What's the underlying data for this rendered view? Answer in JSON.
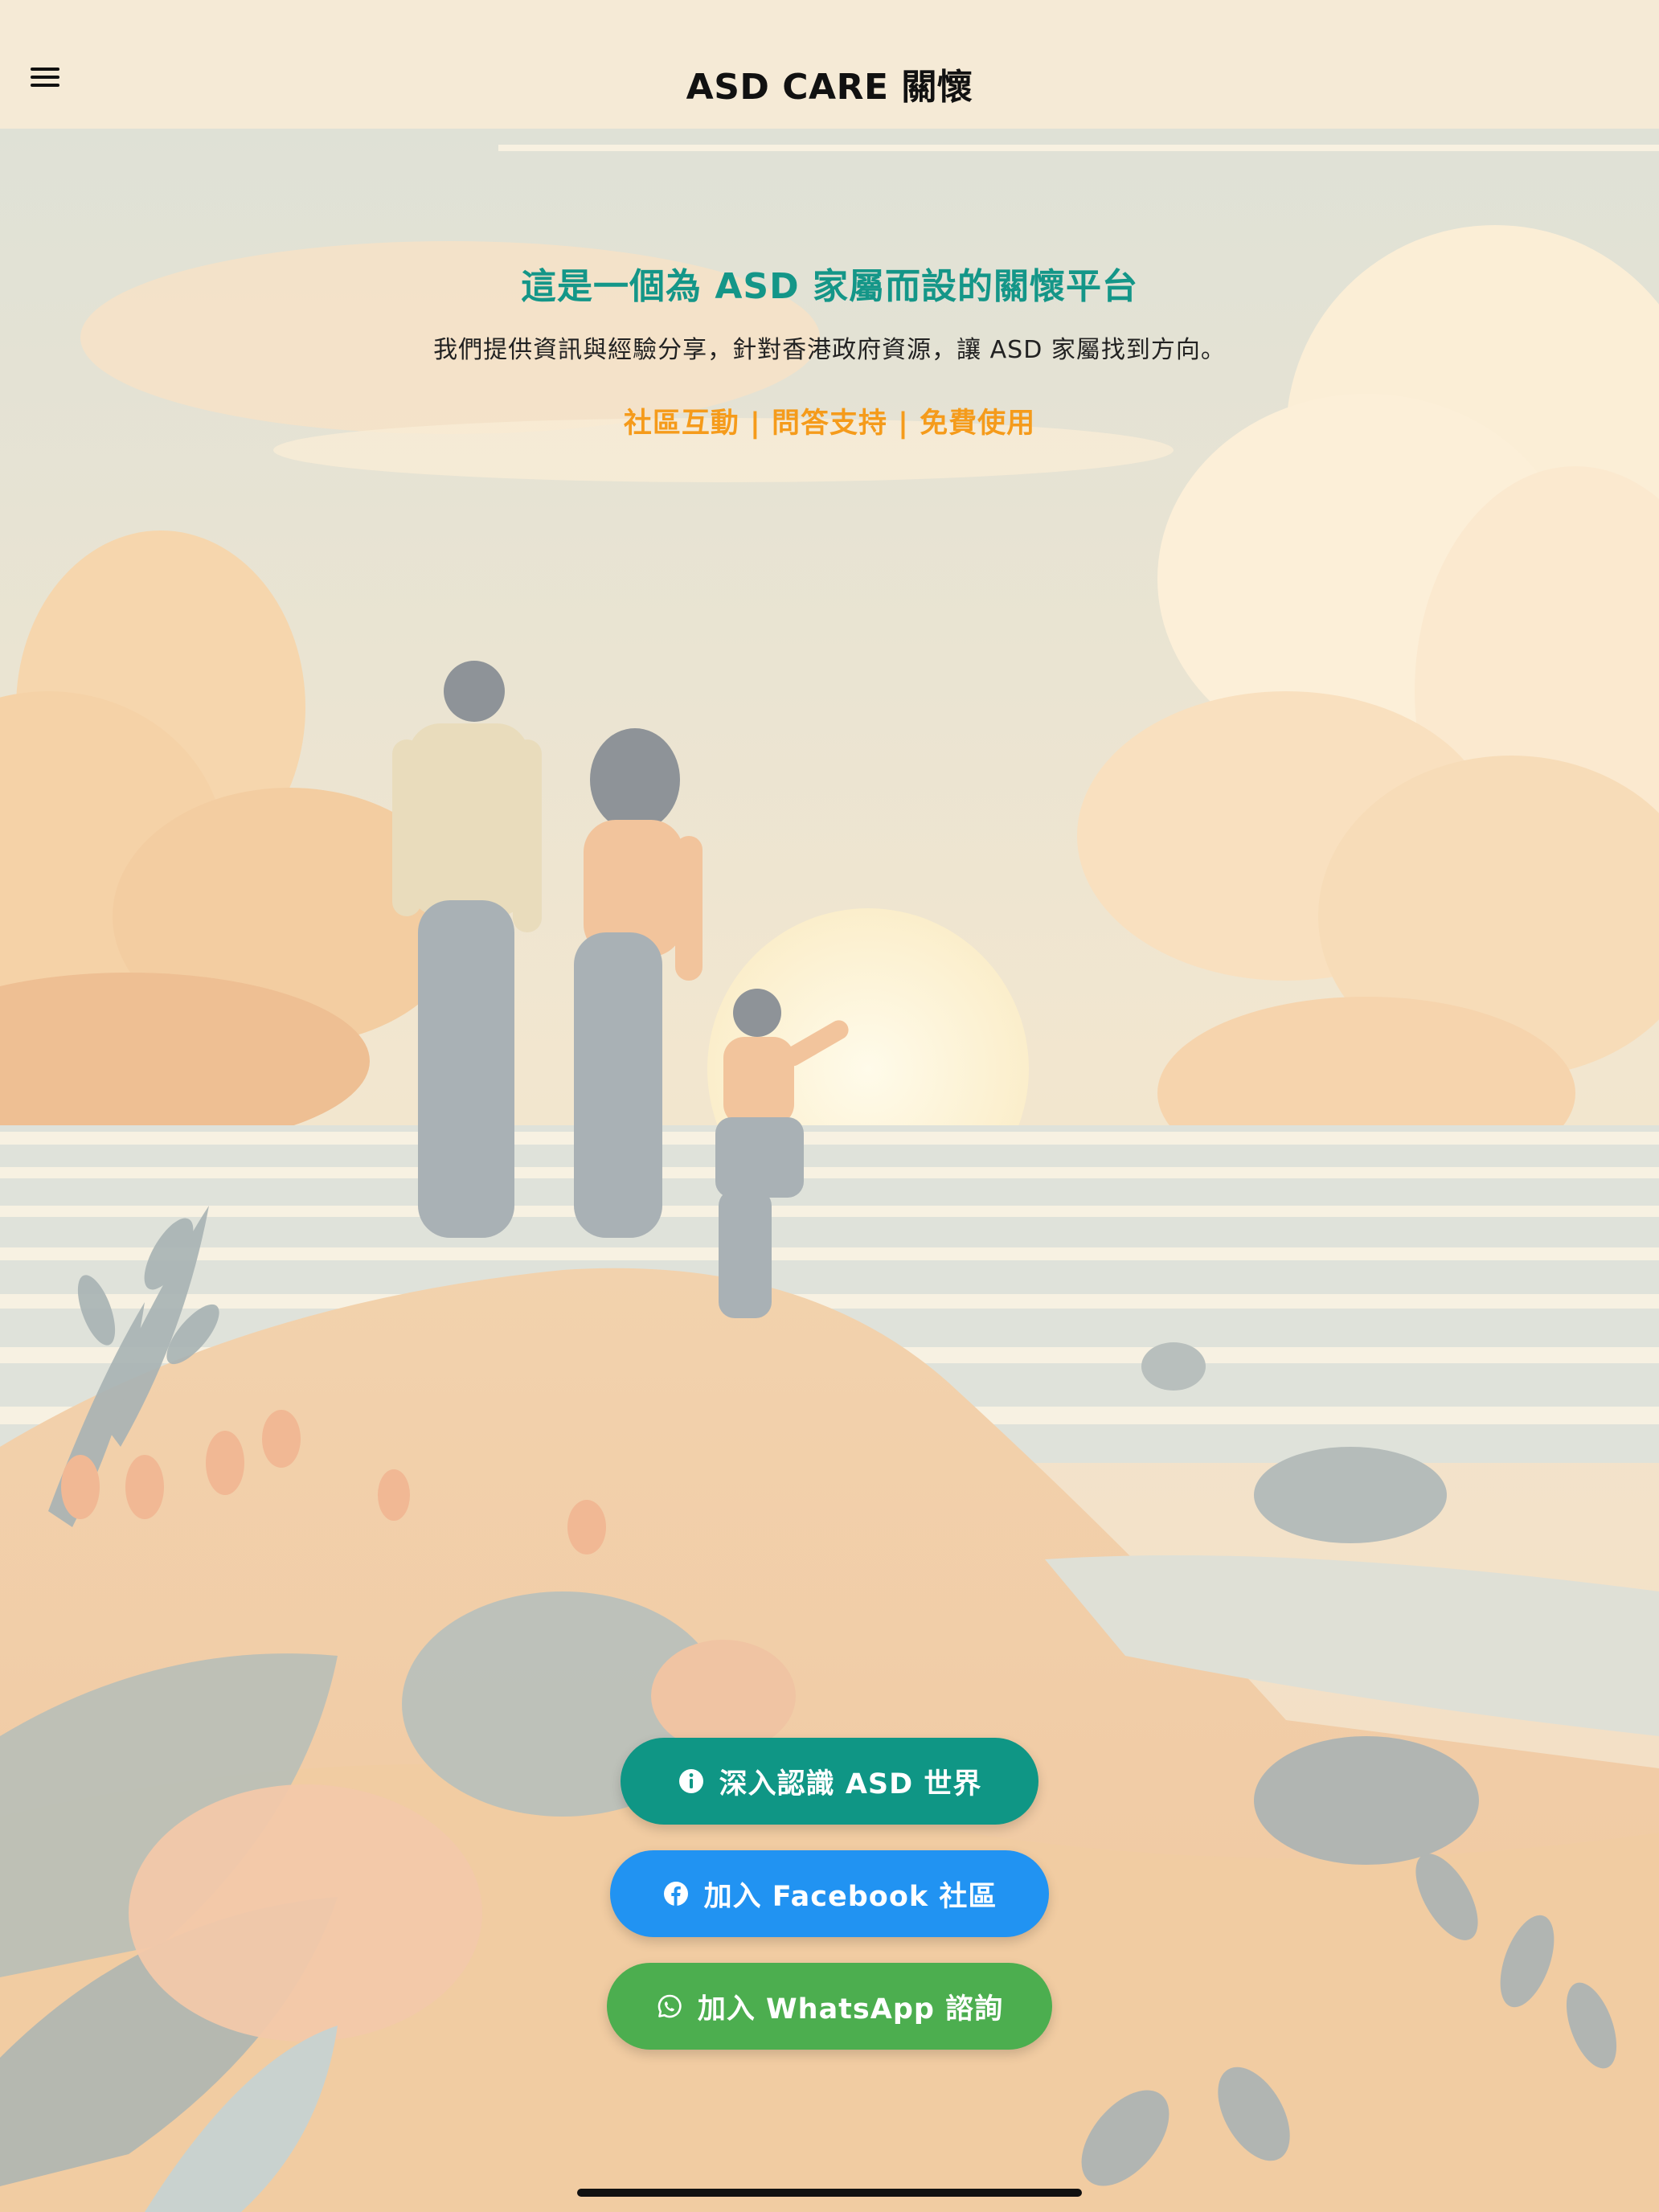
{
  "header": {
    "title": "ASD CARE 關懷",
    "menu_icon": "hamburger-menu-icon"
  },
  "intro": {
    "headline": "這是一個為 ASD 家屬而設的關懷平台",
    "subline": "我們提供資訊與經驗分享，針對香港政府資源，讓 ASD 家屬找到方向。",
    "tagline": "社區互動 | 問答支持 | 免費使用"
  },
  "actions": [
    {
      "label": "深入認識 ASD 世界",
      "icon": "info-icon",
      "color": "#0f9685"
    },
    {
      "label": "加入 Facebook 社區",
      "icon": "facebook-icon",
      "color": "#2193f2"
    },
    {
      "label": "加入 WhatsApp 諮詢",
      "icon": "whatsapp-icon",
      "color": "#4cae4f"
    }
  ],
  "colors": {
    "headline": "#149688",
    "tagline": "#f59b1b",
    "background": "#f5ead6"
  }
}
